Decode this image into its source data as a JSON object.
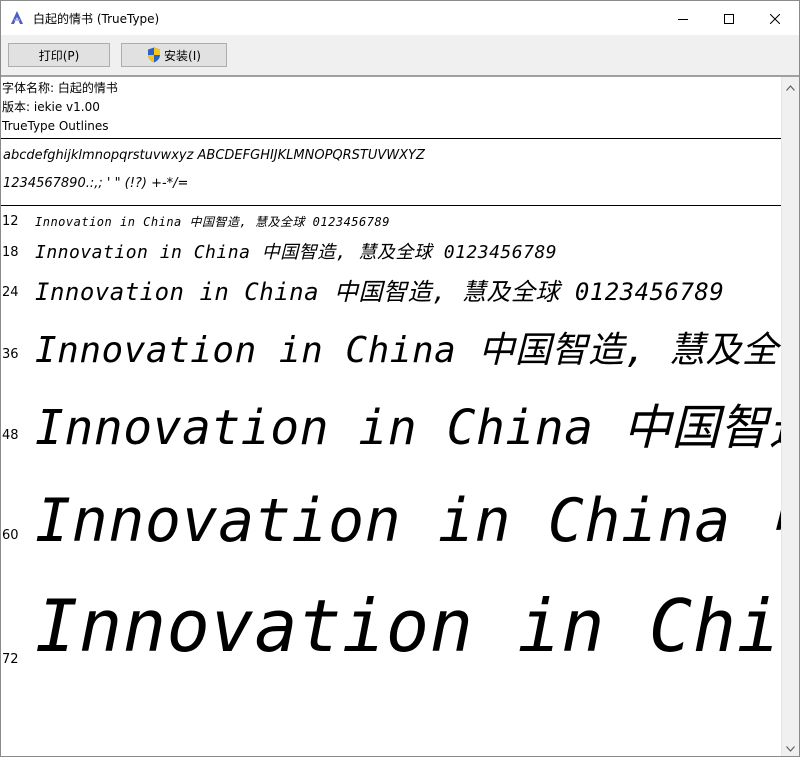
{
  "window": {
    "title": "白起的情书 (TrueType)"
  },
  "toolbar": {
    "print_label": "打印(P)",
    "install_label": "安装(I)"
  },
  "font_info": {
    "name_line": "字体名称: 白起的情书",
    "version_line": "版本: iekie v1.00",
    "outline_line": "TrueType Outlines"
  },
  "charset": {
    "line1": "abcdefghijklmnopqrstuvwxyz ABCDEFGHIJKLMNOPQRSTUVWXYZ",
    "line2": "1234567890.:,; ' \" (!?) +-*/="
  },
  "samples": [
    {
      "size": "12",
      "text": "Innovation in China 中国智造, 慧及全球 0123456789"
    },
    {
      "size": "18",
      "text": "Innovation in China 中国智造, 慧及全球 0123456789"
    },
    {
      "size": "24",
      "text": "Innovation in China 中国智造, 慧及全球 0123456789"
    },
    {
      "size": "36",
      "text": "Innovation in China 中国智造, 慧及全"
    },
    {
      "size": "48",
      "text": "Innovation in China 中国智造"
    },
    {
      "size": "60",
      "text": "Innovation in China 中国"
    },
    {
      "size": "72",
      "text": "Innovation in China"
    }
  ]
}
